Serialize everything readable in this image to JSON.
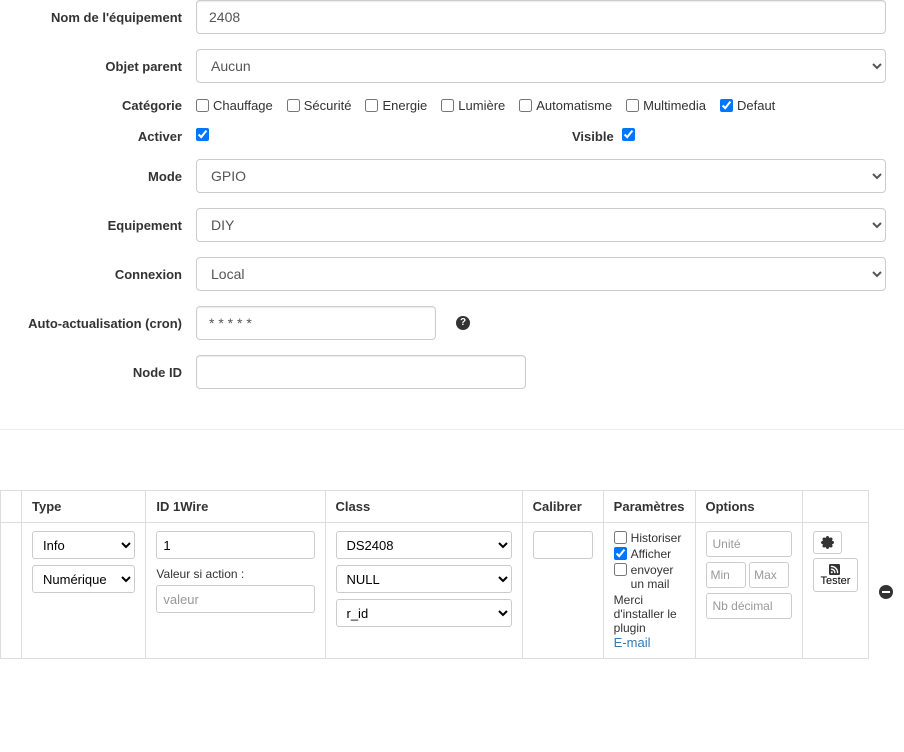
{
  "form": {
    "labels": {
      "name": "Nom de l'équipement",
      "parent": "Objet parent",
      "category": "Catégorie",
      "activate": "Activer",
      "visible": "Visible",
      "mode": "Mode",
      "equipment": "Equipement",
      "connection": "Connexion",
      "autorefresh": "Auto-actualisation (cron)",
      "nodeid": "Node ID"
    },
    "values": {
      "name": "2408",
      "parent": "Aucun",
      "mode": "GPIO",
      "equipment": "DIY",
      "connection": "Local",
      "autorefresh": "* * * * *",
      "nodeid": ""
    },
    "categories": [
      {
        "label": "Chauffage",
        "checked": false
      },
      {
        "label": "Sécurité",
        "checked": false
      },
      {
        "label": "Energie",
        "checked": false
      },
      {
        "label": "Lumière",
        "checked": false
      },
      {
        "label": "Automatisme",
        "checked": false
      },
      {
        "label": "Multimedia",
        "checked": false
      },
      {
        "label": "Defaut",
        "checked": true
      }
    ],
    "activate_checked": true,
    "visible_checked": true
  },
  "table": {
    "headers": {
      "type": "Type",
      "id1wire": "ID 1Wire",
      "class": "Class",
      "calibrer": "Calibrer",
      "parametres": "Paramètres",
      "options": "Options"
    },
    "row": {
      "type_select1": "Info",
      "type_select2": "Numérique",
      "id1wire_value": "1",
      "valeur_si_action_label": "Valeur si action :",
      "valeur_placeholder": "valeur",
      "class_select1": "DS2408",
      "class_select2": "NULL",
      "class_select3": "r_id",
      "param_historiser": "Historiser",
      "param_afficher": "Afficher",
      "param_envoyer": "envoyer un mail",
      "param_merci": "Merci d'installer le plugin",
      "param_email_link": "E-mail",
      "opt_unite": "Unité",
      "opt_min": "Min",
      "opt_max": "Max",
      "opt_decimal": "Nb décimal",
      "tester_label": "Tester"
    }
  }
}
